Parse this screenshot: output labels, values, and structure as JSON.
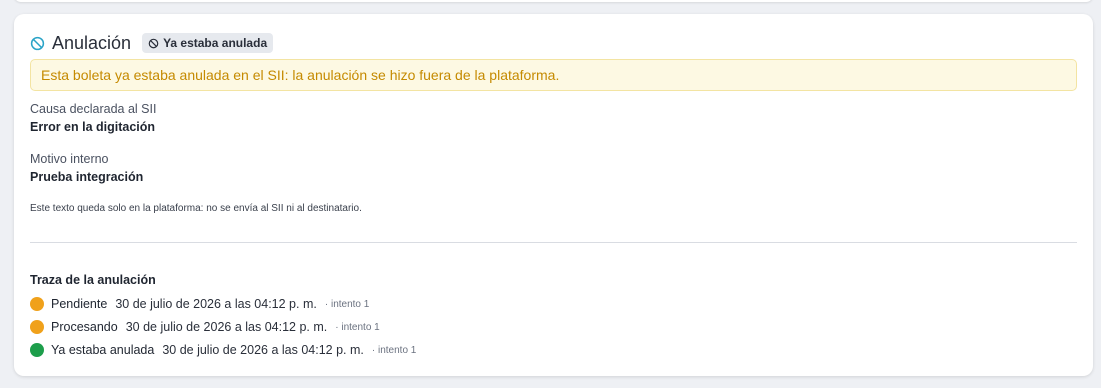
{
  "section": {
    "title": "Anulación",
    "badge": "Ya estaba anulada",
    "alert": "Esta boleta ya estaba anulada en el SII: la anulación se hizo fuera de la plataforma."
  },
  "fields": {
    "cause_label": "Causa declarada al SII",
    "cause_value": "Error en la digitación",
    "reason_label": "Motivo interno",
    "reason_value": "Prueba integración",
    "note": "Este texto queda solo en la plataforma: no se envía al SII ni al destinatario."
  },
  "trace": {
    "title": "Traza de la anulación",
    "items": [
      {
        "status": "Pendiente",
        "date": "30 de julio de 2026 a las 04:12 p. m.",
        "attempt": "· intento 1",
        "color": "#f0a11b"
      },
      {
        "status": "Procesando",
        "date": "30 de julio de 2026 a las 04:12 p. m.",
        "attempt": "· intento 1",
        "color": "#f0a11b"
      },
      {
        "status": "Ya estaba anulada",
        "date": "30 de julio de 2026 a las 04:12 p. m.",
        "attempt": "· intento 1",
        "color": "#1d9e4b"
      }
    ]
  },
  "colors": {
    "icon_accent": "#2aa3c7",
    "alert_text": "#c58a00",
    "alert_bg": "#fdf9e3"
  }
}
